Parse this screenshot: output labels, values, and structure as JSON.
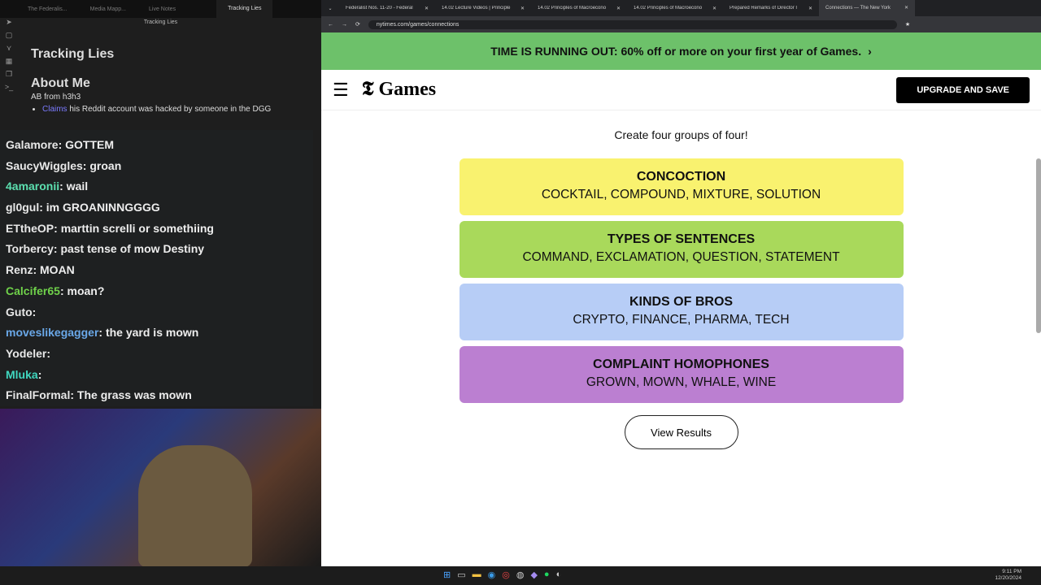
{
  "obsidian": {
    "tabs": [
      "The Federalis...",
      "Media Mapp...",
      "Live Notes",
      "Tracking Lies"
    ],
    "view_title": "Tracking Lies",
    "note": {
      "title": "Tracking Lies",
      "heading": "About Me",
      "subtitle": "AB from h3h3",
      "item1_link": "Claims",
      "item1_text": " his Reddit account was hacked by someone in the DGG"
    }
  },
  "chat": [
    {
      "user": "Galamore",
      "msg": "GOTTEM",
      "color": "#e8e8e8"
    },
    {
      "user": "SaucyWiggles",
      "msg": "groan",
      "color": "#e8e8e8"
    },
    {
      "user": "4amaronii",
      "msg": "wail",
      "color": "#5ce0b0"
    },
    {
      "user": "gl0gul",
      "msg": "im GROANINNGGGG",
      "color": "#e8e8e8"
    },
    {
      "user": "ETtheOP",
      "msg": "marttin screlli or somethiing",
      "color": "#e8e8e8"
    },
    {
      "user": "Torbercy",
      "msg": "past tense of mow Destiny",
      "color": "#e8e8e8"
    },
    {
      "user": "Renz",
      "msg": "MOAN",
      "color": "#e8e8e8"
    },
    {
      "user": "Calcifer65",
      "msg": "moan?",
      "color": "#6fd14a"
    },
    {
      "user": "Guto",
      "msg": "",
      "color": "#e8e8e8"
    },
    {
      "user": "moveslikegagger",
      "msg": "the yard is mown",
      "color": "#6aa8e8"
    },
    {
      "user": "Yodeler",
      "msg": "",
      "color": "#e8e8e8"
    },
    {
      "user": "Mluka",
      "msg": "",
      "color": "#40d8c0"
    },
    {
      "user": "FinalFormal",
      "msg": "The grass was mown",
      "color": "#e8e8e8"
    }
  ],
  "browser": {
    "tabs": [
      "Federalist Nos. 11-20 - Federal",
      "14.02 Lecture Videos | Principle",
      "14.02 Principles of Macroecono",
      "14.02 Principles of Macroecono",
      "Prepared Remarks of Director I",
      "Connections — The New York"
    ],
    "url": "nytimes.com/games/connections"
  },
  "nyt": {
    "banner": "TIME IS RUNNING OUT: 60% off or more on your first year of Games.",
    "logo": "Games",
    "upgrade": "UPGRADE AND SAVE",
    "instructions": "Create four groups of four!",
    "groups": [
      {
        "name": "CONCOCTION",
        "words": "COCKTAIL, COMPOUND, MIXTURE, SOLUTION",
        "color": "#f9f26f"
      },
      {
        "name": "TYPES OF SENTENCES",
        "words": "COMMAND, EXCLAMATION, QUESTION, STATEMENT",
        "color": "#a9d95b"
      },
      {
        "name": "KINDS OF BROS",
        "words": "CRYPTO, FINANCE, PHARMA, TECH",
        "color": "#b7cdf6"
      },
      {
        "name": "COMPLAINT HOMOPHONES",
        "words": "GROWN, MOWN, WHALE, WINE",
        "color": "#bb7fd1"
      }
    ],
    "view_results": "View Results"
  },
  "taskbar": {
    "time": "9:11 PM",
    "date": "12/20/2024"
  }
}
